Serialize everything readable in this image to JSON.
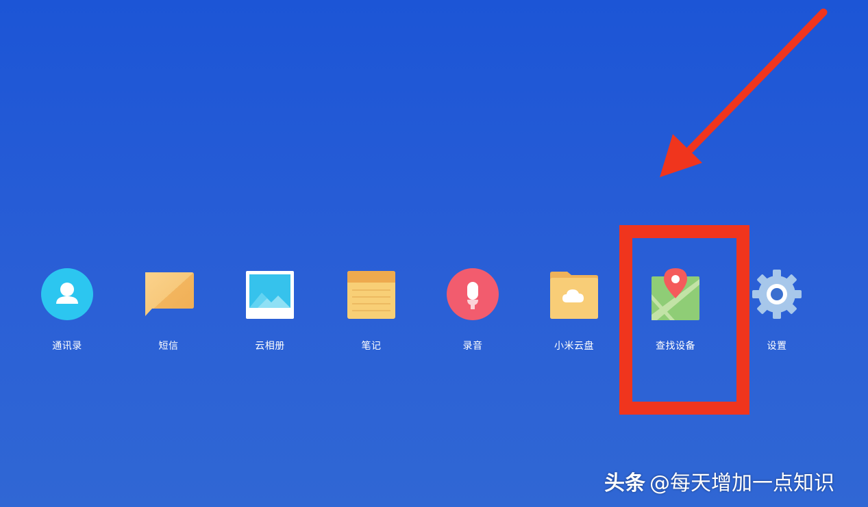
{
  "apps": [
    {
      "label": "通讯录",
      "icon": "contacts-icon"
    },
    {
      "label": "短信",
      "icon": "messages-icon"
    },
    {
      "label": "云相册",
      "icon": "gallery-icon"
    },
    {
      "label": "笔记",
      "icon": "notes-icon"
    },
    {
      "label": "录音",
      "icon": "recorder-icon"
    },
    {
      "label": "小米云盘",
      "icon": "cloud-drive-icon"
    },
    {
      "label": "查找设备",
      "icon": "find-device-icon"
    },
    {
      "label": "设置",
      "icon": "settings-icon"
    }
  ],
  "watermark": {
    "brand": "头条",
    "handle": "@每天增加一点知识"
  },
  "colors": {
    "background": "#1c55d6",
    "annotation_red": "#f0351d",
    "contacts": "#2cc6f0",
    "recorder": "#f25c6e",
    "notes": "#f6c66a",
    "settings": "#a7c7ea"
  }
}
